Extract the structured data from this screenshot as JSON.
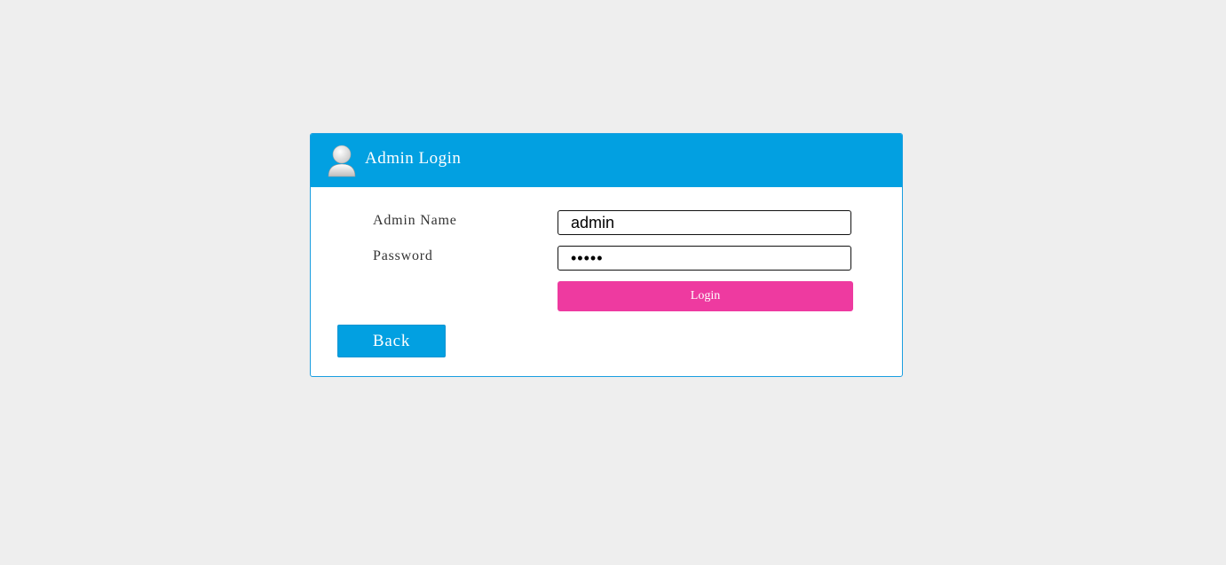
{
  "header": {
    "title": "Admin Login",
    "icon": "user-avatar-icon"
  },
  "form": {
    "name_label": "Admin Name",
    "name_value": "admin",
    "password_label": "Password",
    "password_value": "admin",
    "login_label": "Login"
  },
  "back_label": "Back",
  "colors": {
    "page_background": "#eeeeee",
    "header_blue": "#02a0e1",
    "login_pink": "#ee3aa0",
    "panel_border": "#1a9ee0"
  }
}
